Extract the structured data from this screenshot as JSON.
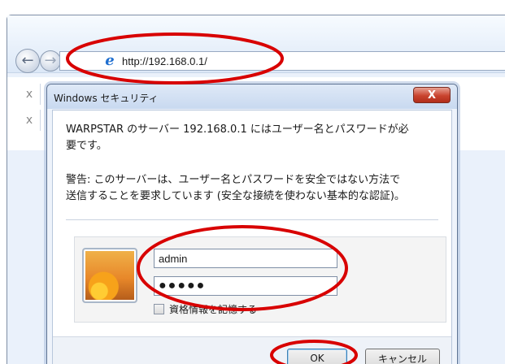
{
  "browser": {
    "address_url": "http://192.168.0.1/",
    "tab_close_glyph": "x"
  },
  "dialog": {
    "title": "Windows セキュリティ",
    "close_glyph": "X",
    "message_lines": [
      "WARPSTAR のサーバー 192.168.0.1 にはユーザー名とパスワードが必",
      "要です。"
    ],
    "warning_lines": [
      "警告: このサーバーは、ユーザー名とパスワードを安全ではない方法で",
      "送信することを要求しています (安全な接続を使わない基本的な認証)。"
    ],
    "username_value": "admin",
    "password_mask": "●●●●●",
    "remember_label": "資格情報を記憶する",
    "ok_label": "OK",
    "cancel_label": "キャンセル"
  },
  "colors": {
    "annotation": "#d80000",
    "close_button": "#c9432e"
  },
  "icons": {
    "back": "back-arrow-icon",
    "forward": "forward-arrow-icon",
    "browser_logo": "ie-logo-icon",
    "close": "close-icon",
    "user_tile": "user-avatar-icon"
  }
}
